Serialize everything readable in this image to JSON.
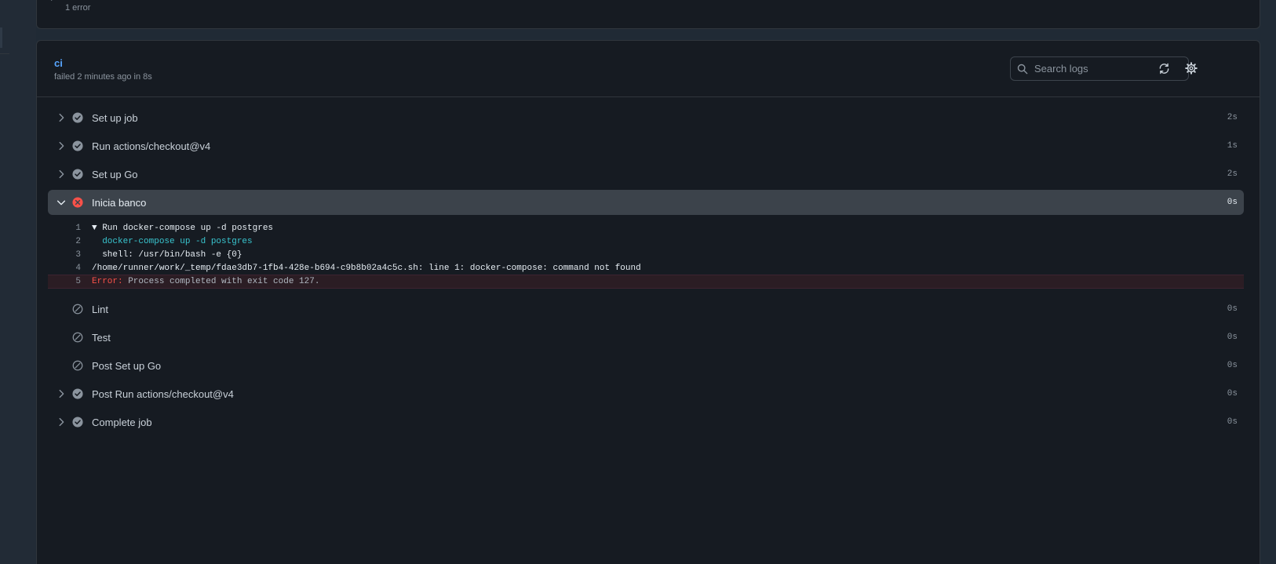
{
  "top_card": {
    "error_summary": "1 error"
  },
  "job": {
    "name": "ci",
    "status": "failed 2 minutes ago in 8s"
  },
  "search": {
    "placeholder": "Search logs"
  },
  "steps": [
    {
      "name": "Set up job",
      "duration": "2s",
      "status": "success",
      "expandable": true
    },
    {
      "name": "Run actions/checkout@v4",
      "duration": "1s",
      "status": "success",
      "expandable": true
    },
    {
      "name": "Set up Go",
      "duration": "2s",
      "status": "success",
      "expandable": true
    },
    {
      "name": "Inicia banco",
      "duration": "0s",
      "status": "failure",
      "expandable": true,
      "expanded": true
    },
    {
      "name": "Lint",
      "duration": "0s",
      "status": "skipped",
      "expandable": false
    },
    {
      "name": "Test",
      "duration": "0s",
      "status": "skipped",
      "expandable": false
    },
    {
      "name": "Post Set up Go",
      "duration": "0s",
      "status": "skipped",
      "expandable": false
    },
    {
      "name": "Post Run actions/checkout@v4",
      "duration": "0s",
      "status": "success",
      "expandable": true
    },
    {
      "name": "Complete job",
      "duration": "0s",
      "status": "success",
      "expandable": true
    }
  ],
  "log_lines": [
    {
      "num": "1",
      "text": "▼ Run docker-compose up -d postgres"
    },
    {
      "num": "2",
      "text": "  docker-compose up -d postgres"
    },
    {
      "num": "3",
      "text": "  shell: /usr/bin/bash -e {0}"
    },
    {
      "num": "4",
      "text": "/home/runner/work/_temp/fdae3db7-1fb4-428e-b694-c9b8b02a4c5c.sh: line 1: docker-compose: command not found"
    },
    {
      "num": "5",
      "error_label": "Error:",
      "text": " Process completed with exit code 127."
    }
  ],
  "icons": {
    "search": "search-icon",
    "refresh": "sync-icon",
    "settings": "gear-icon",
    "success": "check-circle-icon",
    "failure": "x-circle-icon",
    "skipped": "skip-icon"
  },
  "colors": {
    "link": "#58a6ff",
    "success": "#8b949e",
    "failure": "#f85149",
    "command": "#39c5cf"
  }
}
